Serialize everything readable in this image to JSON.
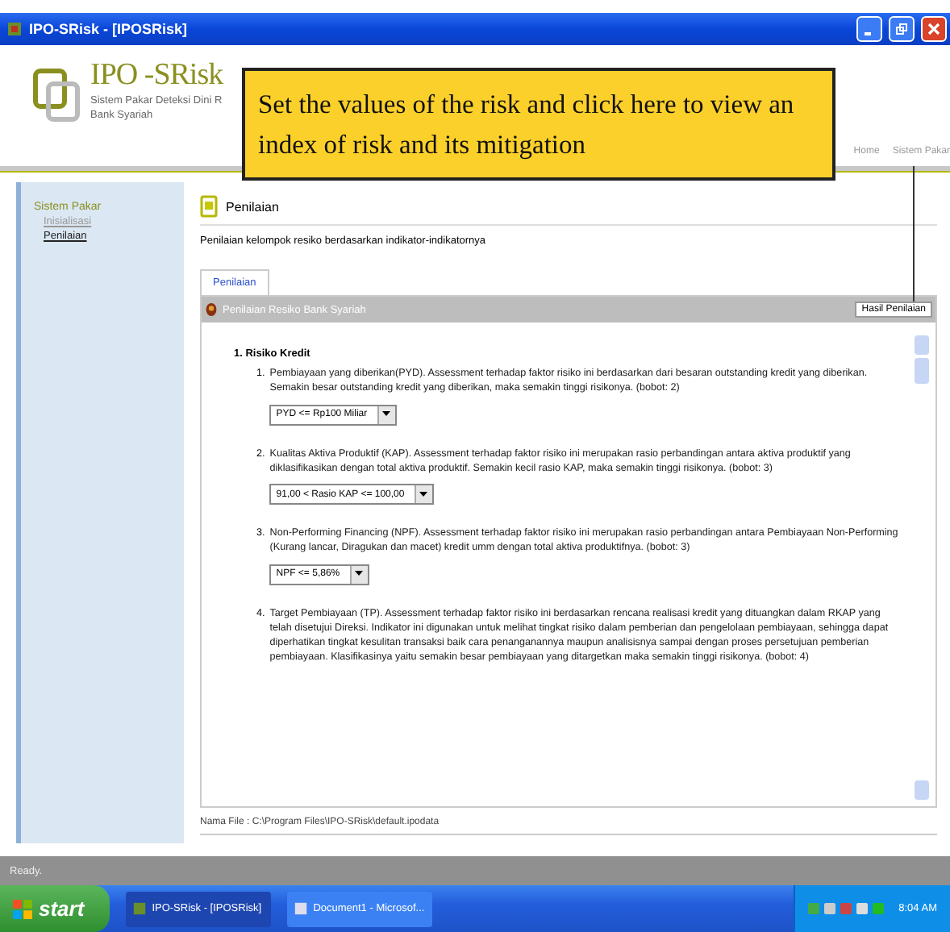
{
  "window": {
    "title": "IPO-SRisk - [IPOSRisk]"
  },
  "header": {
    "app_name": "IPO -SRisk",
    "subtitle": "Sistem Pakar Deteksi Dini R",
    "subtitle_2": "Bank Syariah",
    "nav": [
      "Home",
      "Sistem Pakar"
    ]
  },
  "callout": {
    "text": "Set the values of the risk and click here to view an index of risk and its mitigation"
  },
  "sidebar": {
    "heading": "Sistem Pakar",
    "items": [
      {
        "label": "Inisialisasi",
        "selected": false
      },
      {
        "label": "Penilaian",
        "selected": true
      }
    ]
  },
  "page": {
    "title": "Penilaian",
    "description": "Penilaian kelompok resiko berdasarkan indikator-indikatornya",
    "tabs": [
      {
        "label": "Penilaian",
        "selected": true
      }
    ],
    "panel_title": "Penilaian Resiko Bank Syariah",
    "result_button": "Hasil Penilaian",
    "section": "1. Risiko Kredit",
    "items": [
      {
        "number": "1.",
        "text": "Pembiayaan yang diberikan(PYD). Assessment terhadap faktor risiko ini berdasarkan dari besaran outstanding kredit yang diberikan. Semakin besar outstanding kredit yang diberikan, maka semakin tinggi risikonya. (bobot: 2)",
        "select": "PYD <= Rp100 Miliar"
      },
      {
        "number": "2.",
        "text": "Kualitas Aktiva Produktif (KAP). Assessment terhadap faktor risiko ini merupakan rasio perbandingan antara aktiva produktif yang diklasifikasikan dengan total aktiva produktif. Semakin kecil rasio KAP, maka semakin tinggi risikonya. (bobot: 3)",
        "select": "91,00 < Rasio KAP <= 100,00"
      },
      {
        "number": "3.",
        "text": "Non-Performing Financing (NPF). Assessment terhadap faktor risiko ini merupakan rasio perbandingan antara Pembiayaan Non-Performing (Kurang lancar, Diragukan dan macet) kredit umm dengan total aktiva produktifnya. (bobot: 3)",
        "select": "NPF <= 5,86%"
      },
      {
        "number": "4.",
        "text": "Target Pembiayaan (TP). Assessment terhadap faktor risiko ini berdasarkan rencana realisasi kredit yang dituangkan dalam RKAP yang telah disetujui Direksi. Indikator ini digunakan untuk melihat tingkat risiko dalam pemberian dan pengelolaan pembiayaan, sehingga dapat diperhatikan tingkat kesulitan transaksi baik cara penanganannya maupun analisisnya sampai dengan proses persetujuan pemberian pembiayaan. Klasifikasinya yaitu semakin besar pembiayaan yang ditargetkan maka semakin tinggi risikonya. (bobot: 4)"
      }
    ],
    "file": "Nama File : C:\\Program Files\\IPO-SRisk\\default.ipodata"
  },
  "status_bar": "Ready.",
  "taskbar": {
    "start": "start",
    "tasks": [
      {
        "label": "IPO-SRisk - [IPOSRisk]",
        "selected": true
      },
      {
        "label": "Document1 - Microsof...",
        "selected": false
      }
    ],
    "clock": "8:04 AM"
  }
}
